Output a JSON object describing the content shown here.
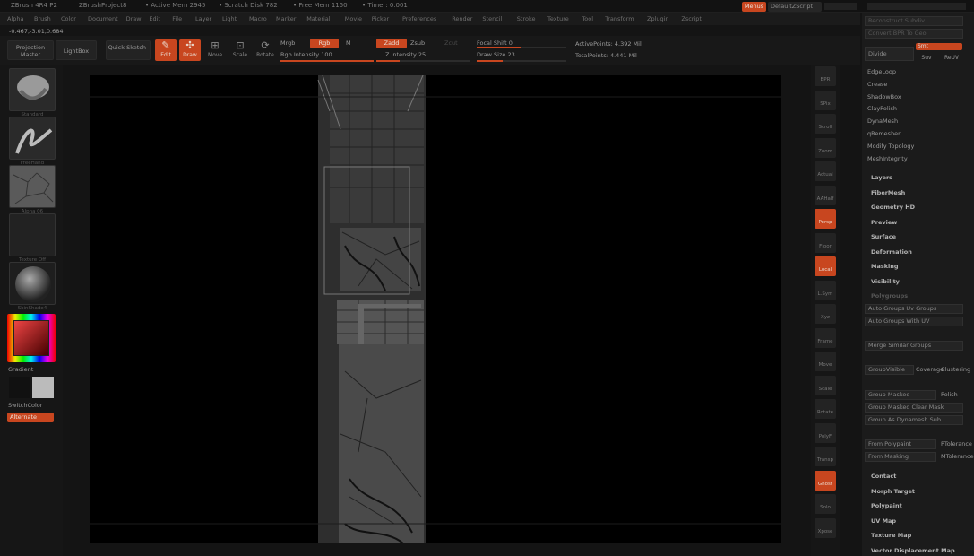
{
  "titlebar": {
    "app": "ZBrush 4R4 P2",
    "project": "ZBrushProject8",
    "active_mem": "• Active Mem 2945",
    "scratch": "• Scratch Disk 782",
    "free_mem": "• Free Mem 1150",
    "timer": "• Timer: 0.001",
    "menus_label": "Menus",
    "script_label": "DefaultZScript"
  },
  "menubar": [
    "Alpha",
    "Brush",
    "Color",
    "Document",
    "Draw",
    "Edit",
    "File",
    "Layer",
    "Light",
    "Macro",
    "Marker",
    "Material",
    "Movie",
    "Picker",
    "Preferences",
    "Render",
    "Stencil",
    "Stroke",
    "Texture",
    "Tool",
    "Transform",
    "Zplugin",
    "Zscript"
  ],
  "coords": "-0.467,-3.01,0.684",
  "top": {
    "projection_master": "Projection Master",
    "lightbox": "LightBox",
    "quick_sketch": "Quick Sketch",
    "edit": "Edit",
    "draw": "Draw",
    "move": "Move",
    "scale": "Scale",
    "rotate": "Rotate",
    "mrgb": "Mrgb",
    "rgb": "Rgb",
    "m": "M",
    "zadd": "Zadd",
    "zsub": "Zsub",
    "zcut": "Zcut",
    "rgb_intensity": "Rgb Intensity 100",
    "z_intensity": "Z Intensity 25",
    "focal_shift": "Focal Shift 0",
    "draw_size": "Draw Size 23",
    "active_points": "ActivePoints: 4.392 Mil",
    "total_points": "TotalPoints: 4.441 Mil",
    "rgb_intensity_value": 100,
    "z_intensity_value": 25,
    "focal_shift_value": 0,
    "draw_size_value": 23
  },
  "left": {
    "brush_cap": "Standard",
    "stroke_cap": "FreeHand",
    "alpha_cap": "Alpha 06",
    "texture_cap": "Texture Off",
    "material_cap": "SkinShade4",
    "gradient": "Gradient",
    "switch_color": "SwitchColor",
    "alternate": "Alternate"
  },
  "right_tools": [
    "BPR",
    "SPix",
    "Scroll",
    "Zoom",
    "Actual",
    "AAHalf",
    "Persp",
    "Floor",
    "Local",
    "L.Sym",
    "Xyz",
    "Frame",
    "Move",
    "Scale",
    "Rotate",
    "PolyF",
    "Transp",
    "Ghost",
    "Solo",
    "Xpose"
  ],
  "panel": {
    "reconstruct": "Reconstruct Subdiv",
    "convert": "Convert BPR To Geo",
    "divide": "Divide",
    "smt": "Smt",
    "suv": "Suv",
    "reluv": "ReUV",
    "deform_items": [
      "EdgeLoop",
      "Crease",
      "ShadowBox",
      "ClayPolish",
      "DynaMesh",
      "qRemesher",
      "Modify Topology",
      "MeshIntegrity"
    ],
    "sections_a": [
      "Layers",
      "FiberMesh",
      "Geometry HD",
      "Preview",
      "Surface",
      "Deformation",
      "Masking",
      "Visibility"
    ],
    "polygroups": "Polygroups",
    "auto_groups_uv": "Auto Groups  Uv Groups",
    "auto_groups_uv_on": "Auto Groups With UV",
    "merge_similar": "Merge Similar Groups",
    "group_visible": "GroupVisible",
    "coverage": "Coverage",
    "clustering": "Clustering",
    "group_masked": "Group Masked",
    "polish": "Polish",
    "group_masked_clear": "Group Masked Clear Mask",
    "group_as_dynamesh": "Group As Dynamesh Sub",
    "from_polypaint": "From Polypaint",
    "ptolerance": "PTolerance",
    "from_masking": "From Masking",
    "mtolerance": "MTolerance",
    "sections_b": [
      "Contact",
      "Morph Target",
      "Polypaint",
      "UV Map",
      "Texture Map",
      "Vector Displacement Map"
    ]
  },
  "colors": {
    "accent": "#c8461f",
    "bg": "#141414"
  }
}
